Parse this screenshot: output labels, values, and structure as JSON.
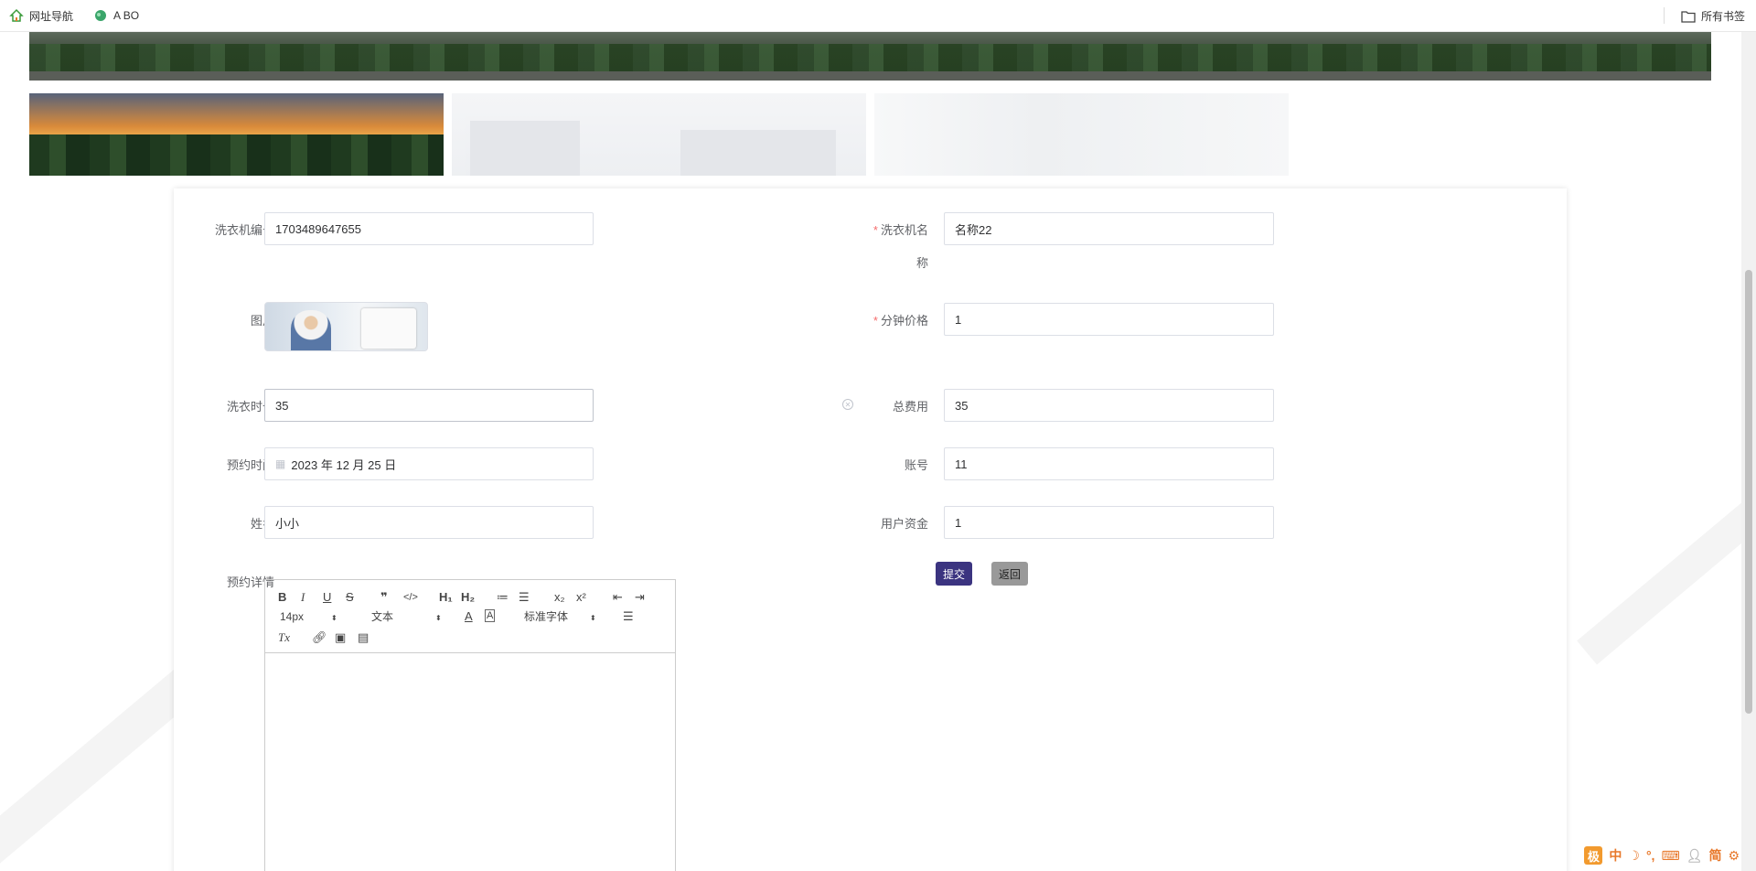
{
  "bookmarks": {
    "items": [
      {
        "label": "网址导航",
        "icon": "house-icon"
      },
      {
        "label": "A BO",
        "icon": "leaf-icon"
      }
    ],
    "all_bookmarks_label": "所有书签"
  },
  "form": {
    "fields": {
      "machine_no_label": "洗衣机编号",
      "machine_no_value": "1703489647655",
      "machine_name_label_1": "洗衣机名",
      "machine_name_label_2": "称",
      "machine_name_value": "名称22",
      "image_label": "图片",
      "price_per_min_label": "分钟价格",
      "price_per_min_value": "1",
      "duration_label": "洗衣时长",
      "duration_value": "35",
      "total_label": "总费用",
      "total_value": "35",
      "booking_time_label": "预约时间",
      "booking_time_value": "2023 年 12 月 25 日",
      "account_label": "账号",
      "account_value": "11",
      "name_label": "姓名",
      "name_value": "小小",
      "user_funds_label": "用户资金",
      "user_funds_value": "1",
      "details_label": "预约详情"
    },
    "buttons": {
      "submit": "提交",
      "back": "返回"
    },
    "required_mark": "*"
  },
  "editor": {
    "tools": {
      "bold": "B",
      "italic": "I",
      "underline": "U",
      "strike": "S",
      "quote": "❞",
      "code": "</>",
      "h1": "H₁",
      "h2": "H₂",
      "ordered": "≔",
      "bullet": "☰",
      "sub": "x₂",
      "sup": "x²",
      "outdent": "⇤",
      "indent": "⇥",
      "size": "14px",
      "header": "文本",
      "font": "标准字体",
      "clean": "Tx"
    }
  },
  "ime": {
    "lang": "中",
    "mode": "简"
  },
  "colors": {
    "primary": "#3b3480",
    "required": "#f56c6c",
    "back_button": "#999999"
  }
}
